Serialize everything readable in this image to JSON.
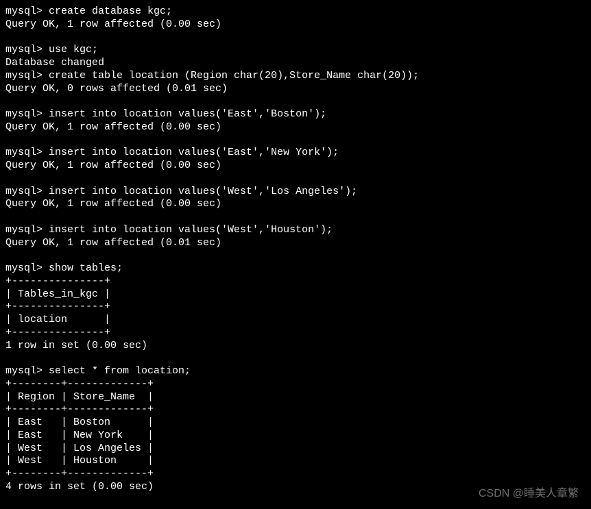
{
  "terminal": {
    "prompt": "mysql>",
    "lines": [
      "mysql> create database kgc;",
      "Query OK, 1 row affected (0.00 sec)",
      "",
      "mysql> use kgc;",
      "Database changed",
      "mysql> create table location (Region char(20),Store_Name char(20));",
      "Query OK, 0 rows affected (0.01 sec)",
      "",
      "mysql> insert into location values('East','Boston');",
      "Query OK, 1 row affected (0.00 sec)",
      "",
      "mysql> insert into location values('East','New York');",
      "Query OK, 1 row affected (0.00 sec)",
      "",
      "mysql> insert into location values('West','Los Angeles');",
      "Query OK, 1 row affected (0.00 sec)",
      "",
      "mysql> insert into location values('West','Houston');",
      "Query OK, 1 row affected (0.01 sec)",
      "",
      "mysql> show tables;",
      "+---------------+",
      "| Tables_in_kgc |",
      "+---------------+",
      "| location      |",
      "+---------------+",
      "1 row in set (0.00 sec)",
      "",
      "mysql> select * from location;",
      "+--------+-------------+",
      "| Region | Store_Name  |",
      "+--------+-------------+",
      "| East   | Boston      |",
      "| East   | New York    |",
      "| West   | Los Angeles |",
      "| West   | Houston     |",
      "+--------+-------------+",
      "4 rows in set (0.00 sec)",
      ""
    ]
  },
  "commands": {
    "create_database": "create database kgc;",
    "use_database": "use kgc;",
    "create_table": "create table location (Region char(20),Store_Name char(20));",
    "insert1": "insert into location values('East','Boston');",
    "insert2": "insert into location values('East','New York');",
    "insert3": "insert into location values('West','Los Angeles');",
    "insert4": "insert into location values('West','Houston');",
    "show_tables": "show tables;",
    "select_all": "select * from location;"
  },
  "tables_result": {
    "header": "Tables_in_kgc",
    "rows": [
      "location"
    ],
    "footer": "1 row in set (0.00 sec)"
  },
  "select_result": {
    "headers": [
      "Region",
      "Store_Name"
    ],
    "rows": [
      {
        "Region": "East",
        "Store_Name": "Boston"
      },
      {
        "Region": "East",
        "Store_Name": "New York"
      },
      {
        "Region": "West",
        "Store_Name": "Los Angeles"
      },
      {
        "Region": "West",
        "Store_Name": "Houston"
      }
    ],
    "footer": "4 rows in set (0.00 sec)"
  },
  "watermark": "CSDN @睡美人章繁"
}
